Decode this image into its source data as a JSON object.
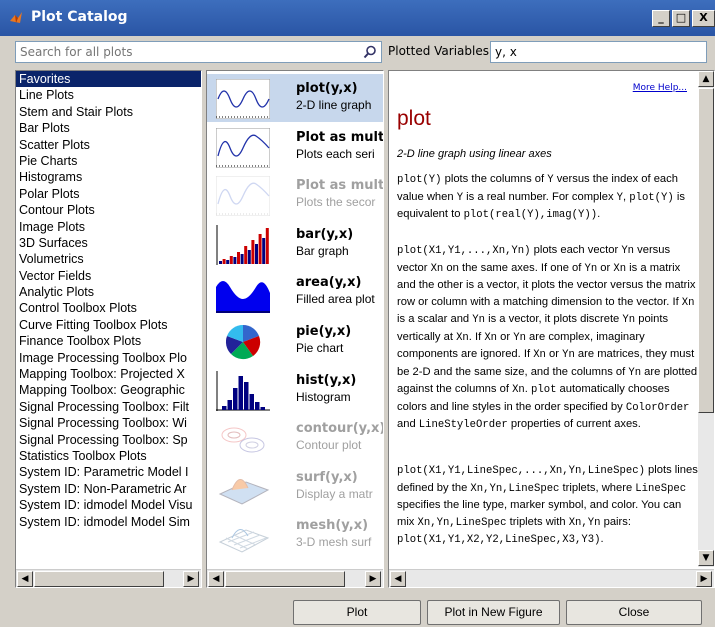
{
  "window": {
    "title": "Plot Catalog"
  },
  "search": {
    "placeholder": "Search for all plots"
  },
  "plotted": {
    "label": "Plotted Variables:",
    "value": "y, x"
  },
  "categories": [
    "Favorites",
    "Line Plots",
    "Stem and Stair Plots",
    "Bar Plots",
    "Scatter Plots",
    "Pie Charts",
    "Histograms",
    "Polar Plots",
    "Contour Plots",
    "Image Plots",
    "3D Surfaces",
    "Volumetrics",
    "Vector Fields",
    "Analytic Plots",
    "Control Toolbox Plots",
    "Curve Fitting Toolbox Plots",
    "Finance Toolbox Plots",
    "Image Processing Toolbox Plo",
    "Mapping Toolbox: Projected X",
    "Mapping Toolbox: Geographic",
    "Signal Processing Toolbox: Filt",
    "Signal Processing Toolbox: Wi",
    "Signal Processing Toolbox: Sp",
    "Statistics Toolbox Plots",
    "System ID: Parametric Model I",
    "System ID: Non-Parametric Ar",
    "System ID: idmodel Model Visu",
    "System ID: idmodel Model Sim"
  ],
  "plots": [
    {
      "name": "plot(y,x)",
      "desc": "2-D line graph",
      "icon": "line-icon"
    },
    {
      "name": "Plot as multi",
      "desc": "Plots each seri",
      "icon": "multi-line-icon"
    },
    {
      "name": "Plot as multi",
      "desc": "Plots the secor",
      "icon": "multi-line-dim-icon"
    },
    {
      "name": "bar(y,x)",
      "desc": "Bar graph",
      "icon": "bar-icon"
    },
    {
      "name": "area(y,x)",
      "desc": "Filled area plot",
      "icon": "area-icon"
    },
    {
      "name": "pie(y,x)",
      "desc": "Pie chart",
      "icon": "pie-icon"
    },
    {
      "name": "hist(y,x)",
      "desc": "Histogram",
      "icon": "histogram-icon"
    },
    {
      "name": "contour(y,x)",
      "desc": "Contour plot",
      "icon": "contour-icon"
    },
    {
      "name": "surf(y,x)",
      "desc": "Display a matr",
      "icon": "surface-icon"
    },
    {
      "name": "mesh(y,x)",
      "desc": "3-D mesh surf",
      "icon": "mesh-icon"
    }
  ],
  "help": {
    "more": "More Help...",
    "title": "plot",
    "subtitle": "2-D line graph using linear axes",
    "p1": [
      "plot(Y)",
      " plots the columns of ",
      "Y",
      " versus the index of each value when ",
      "Y",
      " is a real number. For complex ",
      "Y",
      ", ",
      "plot(Y)",
      " is equivalent to ",
      "plot(real(Y),imag(Y))",
      "."
    ],
    "p2": [
      "plot(X1,Y1,...,Xn,Yn)",
      " plots each vector ",
      "Yn",
      " versus vector ",
      "Xn",
      " on the same axes. If one of ",
      "Yn",
      " or ",
      "Xn",
      " is a matrix and the other is a vector, it plots the vector versus the matrix row or column with a matching dimension to the vector. If ",
      "Xn",
      " is a scalar and ",
      "Yn",
      " is a vector, it plots discrete ",
      "Yn",
      " points vertically at ",
      "Xn",
      ". If ",
      "Xn",
      " or ",
      "Yn",
      " are complex, imaginary components are ignored. If ",
      "Xn",
      " or ",
      "Yn",
      " are matrices, they must be 2-D and the same size, and the columns of ",
      "Yn",
      " are plotted against the columns of ",
      "Xn",
      ". ",
      "plot",
      " automatically chooses colors and line styles in the order specified by ",
      "ColorOrder",
      " and ",
      "LineStyleOrder",
      " properties of current axes."
    ],
    "p3": [
      "plot(X1,Y1,LineSpec,...,Xn,Yn,LineSpec)",
      " plots lines defined by the ",
      "Xn,Yn,LineSpec",
      " triplets, where ",
      "LineSpec",
      " specifies the line type, marker symbol, and color. You can mix ",
      "Xn,Yn,LineSpec",
      " triplets with ",
      "Xn,Yn",
      " pairs: ",
      "plot(X1,Y1,X2,Y2,LineSpec,X3,Y3)",
      "."
    ]
  },
  "buttons": {
    "plot": "Plot",
    "plot_new": "Plot in New Figure",
    "close": "Close"
  }
}
